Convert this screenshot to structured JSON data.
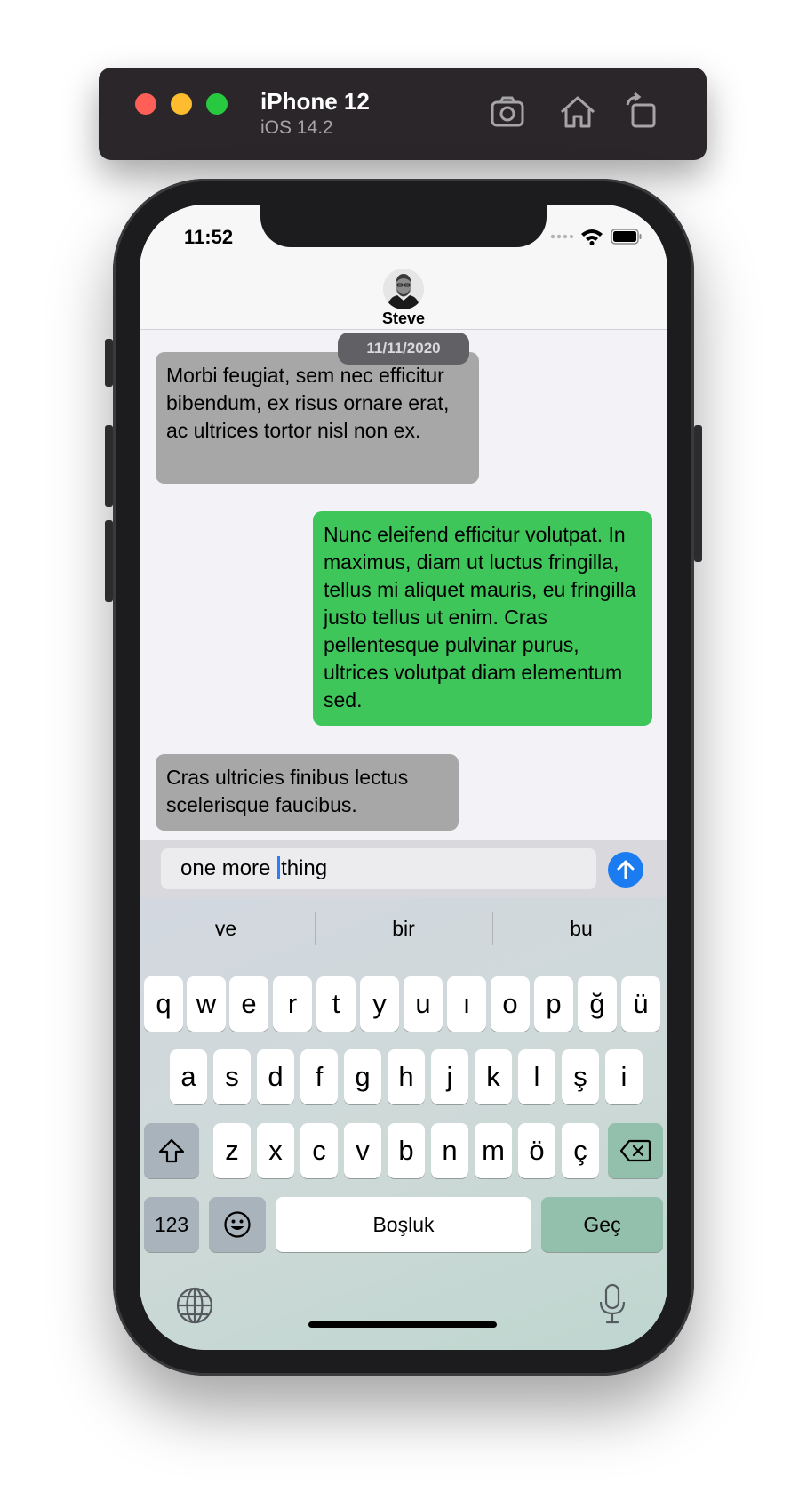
{
  "simulator": {
    "device_name": "iPhone 12",
    "os_version": "iOS 14.2",
    "buttons": [
      "screenshot-icon",
      "home-icon",
      "rotate-icon"
    ]
  },
  "status_bar": {
    "time": "11:52"
  },
  "conversation": {
    "contact_name": "Steve",
    "date": "11/11/2020",
    "messages": [
      {
        "direction": "incoming",
        "text": "Morbi feugiat, sem nec efficitur bibendum, ex risus ornare erat, ac ultrices tortor nisl non ex."
      },
      {
        "direction": "outgoing",
        "text": "Nunc eleifend efficitur volutpat. In maximus, diam ut luctus fringilla, tellus mi aliquet mauris, eu fringilla justo tellus ut enim. Cras pellentesque pulvinar purus, ultrices volutpat diam elementum sed."
      },
      {
        "direction": "incoming",
        "text": "Cras ultricies finibus lectus scelerisque faucibus."
      }
    ],
    "colors": {
      "incoming": "#a7a7a7",
      "outgoing": "#3ec65a",
      "send": "#1b7cf2"
    }
  },
  "composer": {
    "text_before_caret": "one more ",
    "text_after_caret": "thing"
  },
  "keyboard": {
    "suggestions": [
      "ve",
      "bir",
      "bu"
    ],
    "row1": [
      "q",
      "w",
      "e",
      "r",
      "t",
      "y",
      "u",
      "ı",
      "o",
      "p",
      "ğ",
      "ü"
    ],
    "row2": [
      "a",
      "s",
      "d",
      "f",
      "g",
      "h",
      "j",
      "k",
      "l",
      "ş",
      "i"
    ],
    "row3": [
      "z",
      "x",
      "c",
      "v",
      "b",
      "n",
      "m",
      "ö",
      "ç"
    ],
    "numbers_key": "123",
    "space_key": "Boşluk",
    "return_key": "Geç"
  }
}
